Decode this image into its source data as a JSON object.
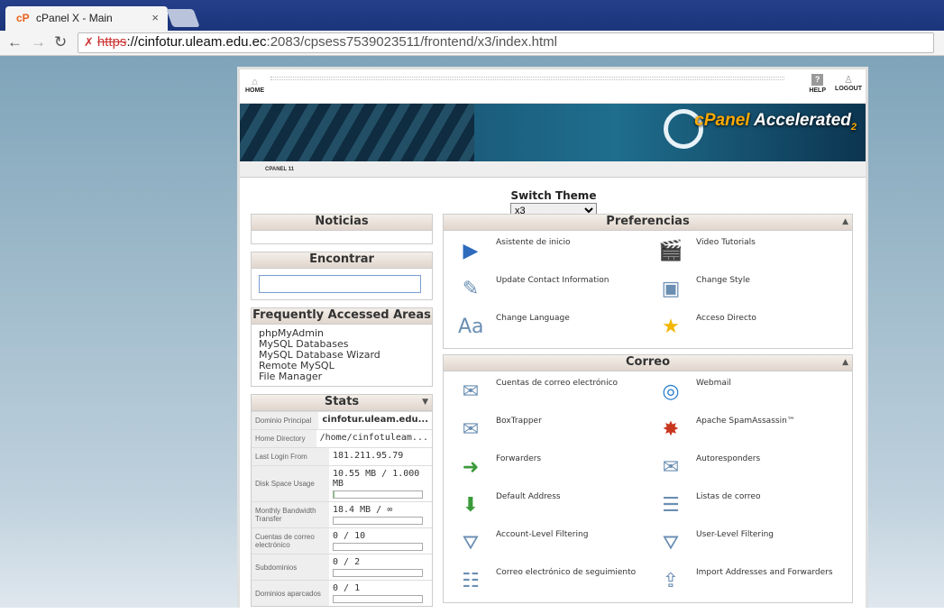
{
  "browser": {
    "tab_title": "cPanel X - Main",
    "tab_close": "×",
    "url_scheme": "https",
    "url_host": "://cinfotur.uleam.edu.ec",
    "url_path": ":2083/cpsess7539023511/frontend/x3/index.html"
  },
  "topnav": {
    "home": "HOME",
    "help": "HELP",
    "logout": "LOGOUT"
  },
  "banner": {
    "logo_prefix": "cPanel",
    "logo_suffix": "Accelerated",
    "logo_sub": "2"
  },
  "breadcrumb": "CPANEL 11",
  "switch_theme": {
    "label": "Switch Theme",
    "selected": "x3"
  },
  "left": {
    "noticias": "Noticias",
    "encontrar": "Encontrar",
    "frequent_title": "Frequently Accessed Areas",
    "frequent": [
      "phpMyAdmin",
      "MySQL Databases",
      "MySQL Database Wizard",
      "Remote MySQL",
      "File Manager"
    ],
    "stats_title": "Stats",
    "stats": [
      {
        "k": "Dominio Principal",
        "v": "cinfotur.uleam.edu..."
      },
      {
        "k": "Home Directory",
        "v": "/home/cinfotuleam..."
      },
      {
        "k": "Last Login From",
        "v": "181.211.95.79"
      },
      {
        "k": "Disk Space Usage",
        "v": "10.55 MB / 1.000 MB",
        "fill": 0.01
      },
      {
        "k": "Monthly Bandwidth Transfer",
        "v": "18.4 MB / ∞",
        "fill": 0
      },
      {
        "k": "Cuentas de correo electrónico",
        "v": "0 / 10",
        "fill": 0
      },
      {
        "k": "Subdominios",
        "v": "0 / 2",
        "fill": 0
      },
      {
        "k": "Dominios aparcados",
        "v": "0 / 1",
        "fill": 0
      }
    ]
  },
  "right": {
    "preferencias_title": "Preferencias",
    "preferencias": [
      {
        "label": "Asistente de inicio",
        "icon": "play-icon"
      },
      {
        "label": "Video Tutorials",
        "icon": "clapperboard-icon"
      },
      {
        "label": "Update Contact Information",
        "icon": "contact-icon"
      },
      {
        "label": "Change Style",
        "icon": "style-icon"
      },
      {
        "label": "Change Language",
        "icon": "language-icon"
      },
      {
        "label": "Acceso Directo",
        "icon": "star-icon"
      }
    ],
    "correo_title": "Correo",
    "correo": [
      {
        "label": "Cuentas de correo electrónico",
        "icon": "envelope-icon"
      },
      {
        "label": "Webmail",
        "icon": "globe-icon"
      },
      {
        "label": "BoxTrapper",
        "icon": "boxtrapper-icon"
      },
      {
        "label": "Apache SpamAssassin™",
        "icon": "spamassassin-icon"
      },
      {
        "label": "Forwarders",
        "icon": "forward-icon"
      },
      {
        "label": "Autoresponders",
        "icon": "autoresponder-icon"
      },
      {
        "label": "Default Address",
        "icon": "default-address-icon"
      },
      {
        "label": "Listas de correo",
        "icon": "mailing-list-icon"
      },
      {
        "label": "Account-Level Filtering",
        "icon": "filter-icon"
      },
      {
        "label": "User-Level Filtering",
        "icon": "user-filter-icon"
      },
      {
        "label": "Correo electrónico de seguimiento",
        "icon": "tracking-icon"
      },
      {
        "label": "Import Addresses and Forwarders",
        "icon": "import-icon"
      }
    ]
  }
}
